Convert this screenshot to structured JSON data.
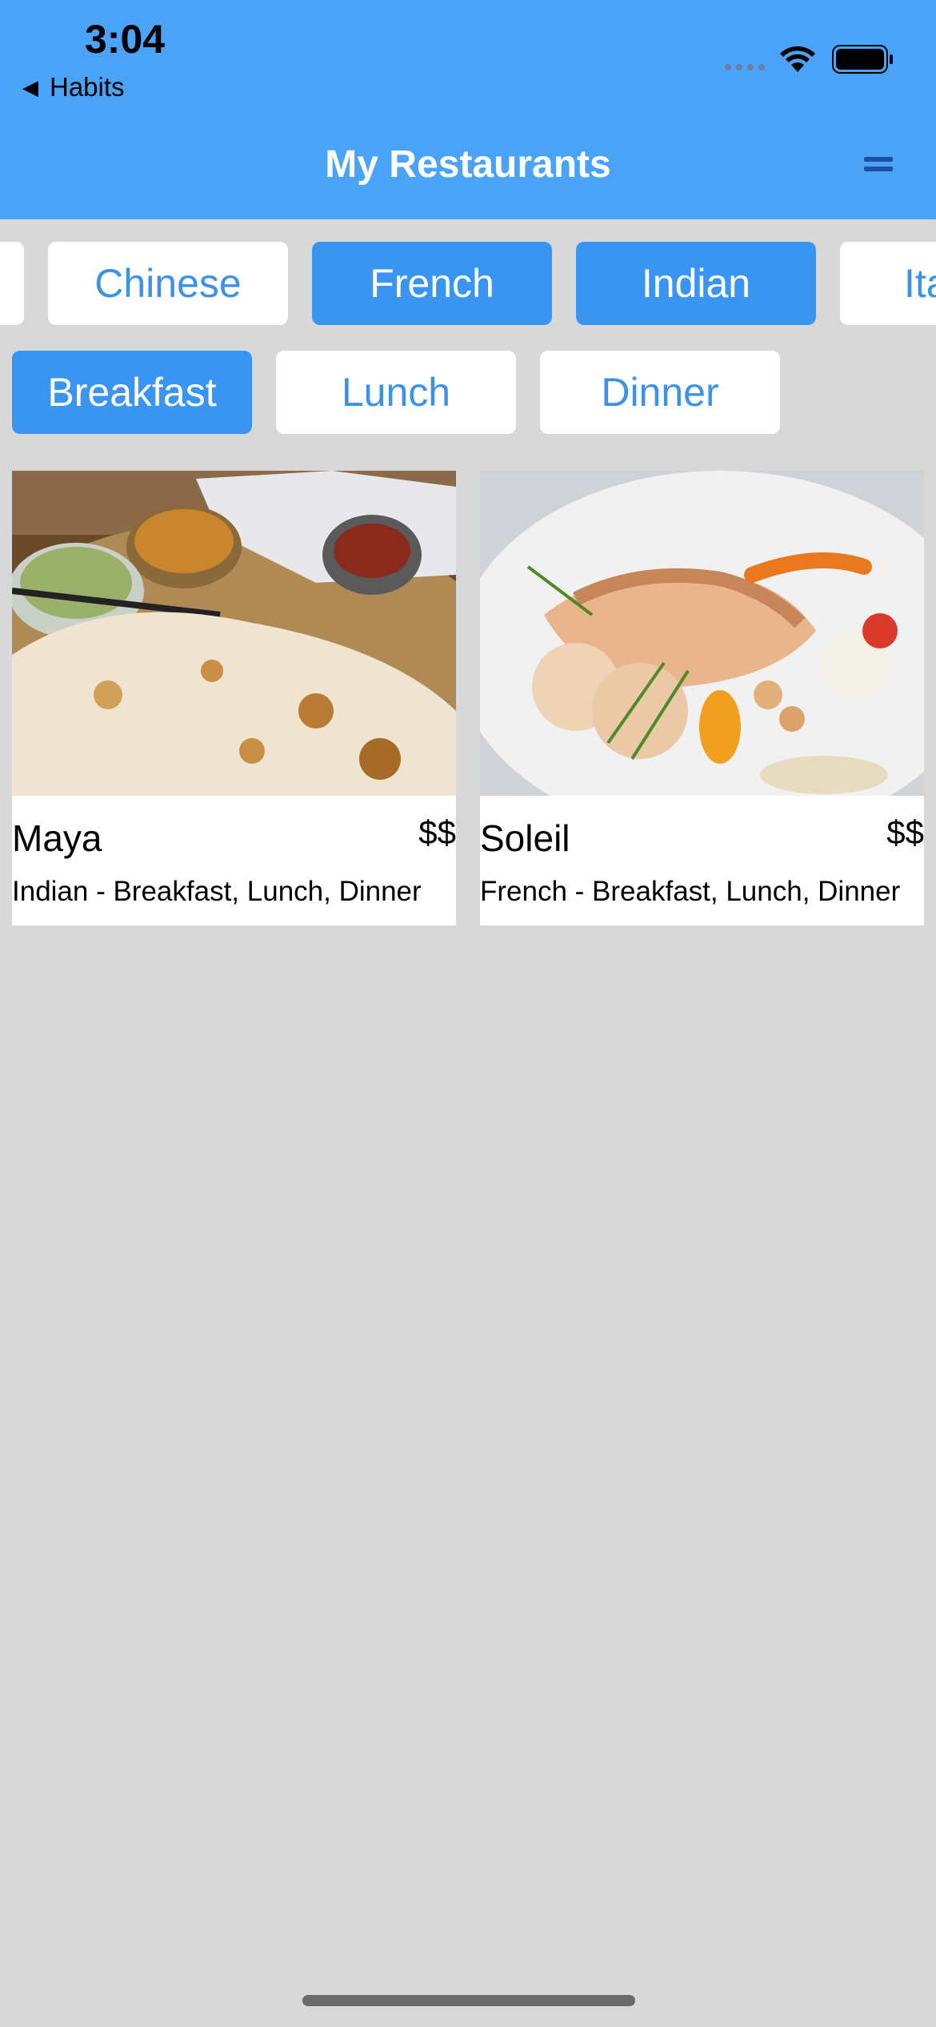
{
  "status_bar": {
    "time": "3:04",
    "back_label": "Habits"
  },
  "nav": {
    "title": "My Restaurants",
    "menu_icon": "menu-icon"
  },
  "cuisine_filters": [
    {
      "label": "",
      "selected": false
    },
    {
      "label": "Chinese",
      "selected": false
    },
    {
      "label": "French",
      "selected": true
    },
    {
      "label": "Indian",
      "selected": true
    },
    {
      "label": "Ita",
      "selected": false
    }
  ],
  "meal_filters": [
    {
      "label": "Breakfast",
      "selected": true
    },
    {
      "label": "Lunch",
      "selected": false
    },
    {
      "label": "Dinner",
      "selected": false
    }
  ],
  "restaurants": [
    {
      "name": "Maya",
      "price": "$$",
      "details": "Indian - Breakfast, Lunch, Dinner"
    },
    {
      "name": "Soleil",
      "price": "$$",
      "details": "French - Breakfast, Lunch, Dinner"
    }
  ],
  "colors": {
    "header": "#4aa3f7",
    "chip_selected": "#3a95f2",
    "chip_text": "#3c92e8",
    "background": "#d8d8d8"
  }
}
